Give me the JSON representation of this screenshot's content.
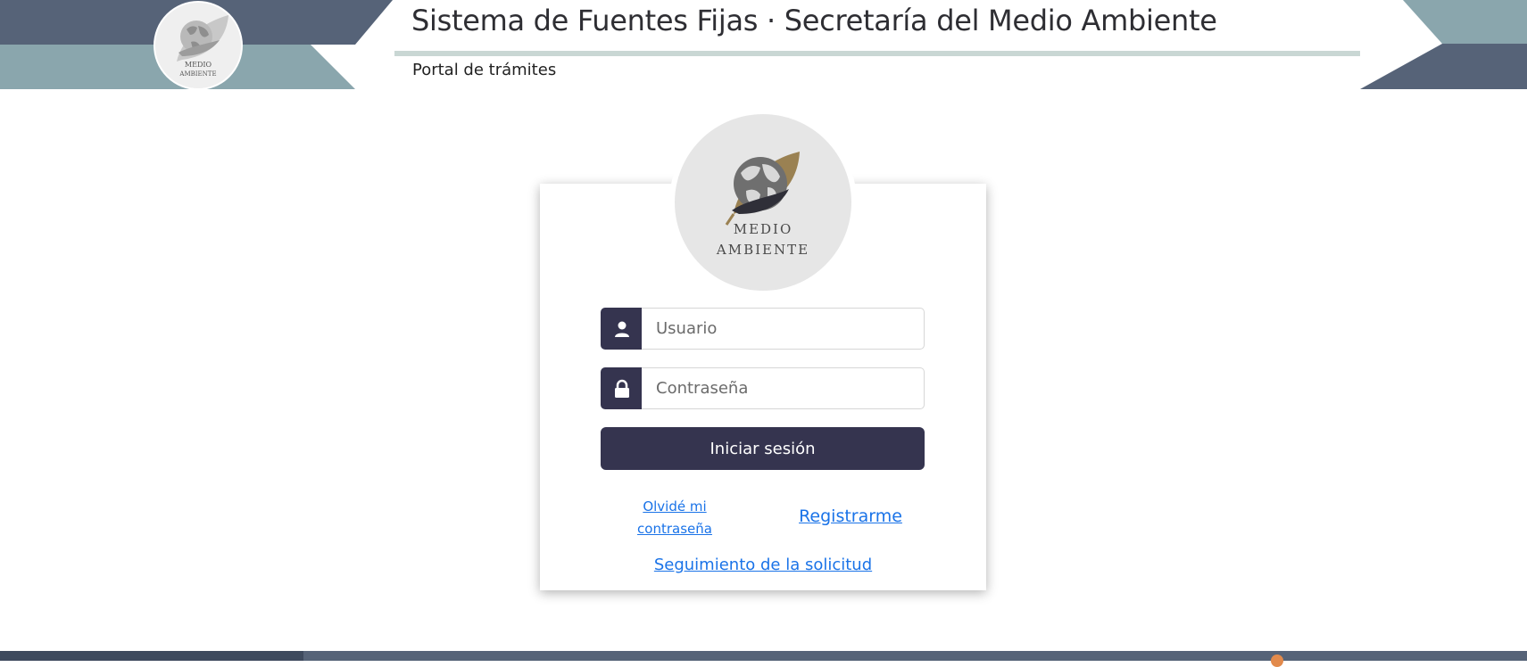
{
  "header": {
    "title": "Sistema de Fuentes Fijas · Secretaría del Medio Ambiente",
    "subtitle": "Portal de trámites",
    "logo_line1": "MEDIO",
    "logo_line2": "AMBIENTE"
  },
  "login": {
    "logo_line1": "MEDIO",
    "logo_line2": "AMBIENTE",
    "username_placeholder": "Usuario",
    "password_placeholder": "Contraseña",
    "submit_label": "Iniciar sesión",
    "forgot_label": "Olvidé mi contraseña",
    "register_label": "Registrarme",
    "tracking_label": "Seguimiento de la solicitud",
    "user_icon": "user-icon",
    "lock_icon": "lock-icon"
  },
  "colors": {
    "header_dark": "#566378",
    "header_light": "#8aa6ad",
    "primary": "#35344f",
    "link": "#1a73e8",
    "logo_gold": "#9a8152"
  }
}
